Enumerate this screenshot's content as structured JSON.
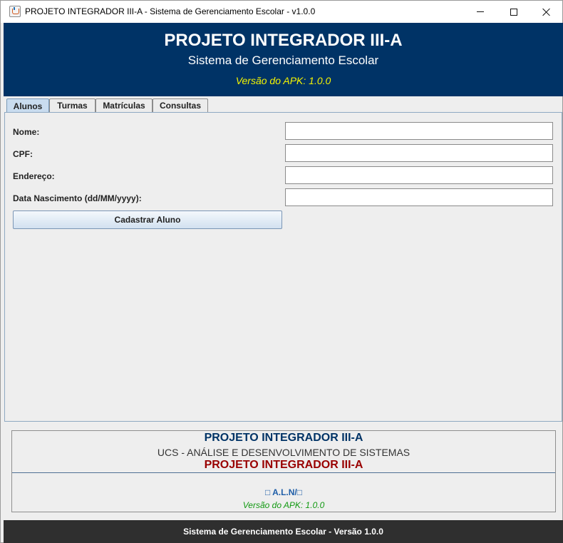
{
  "window": {
    "title": "PROJETO INTEGRADOR III-A - Sistema de Gerenciamento Escolar - v1.0.0",
    "icon": "java-cup-icon"
  },
  "header": {
    "title": "PROJETO INTEGRADOR III-A",
    "subtitle": "Sistema de Gerenciamento Escolar",
    "version": "Versão do APK: 1.0.0",
    "background_color": "#003366",
    "version_color": "#f5f500"
  },
  "tabs": [
    {
      "label": "Alunos",
      "selected": true
    },
    {
      "label": "Turmas",
      "selected": false
    },
    {
      "label": "Matrículas",
      "selected": false
    },
    {
      "label": "Consultas",
      "selected": false
    }
  ],
  "form": {
    "fields": [
      {
        "label": "Nome:",
        "value": ""
      },
      {
        "label": "CPF:",
        "value": ""
      },
      {
        "label": "Endereço:",
        "value": ""
      },
      {
        "label": "Data Nascimento (dd/MM/yyyy):",
        "value": ""
      }
    ],
    "submit_label": "Cadastrar Aluno"
  },
  "info": {
    "title": "PROJETO INTEGRADOR III-A",
    "org": "UCS - ANÁLISE E DESENVOLVIMENTO DE SISTEMAS",
    "project": "PROJETO INTEGRADOR III-A",
    "author": "□ A.L.N/□",
    "version": "Versão do APK: 1.0.0",
    "title_color": "#003366",
    "project_color": "#990000",
    "version_color": "#119911"
  },
  "status_bar": {
    "text": "Sistema de Gerenciamento Escolar - Versão 1.0.0",
    "background_color": "#2f2f2f"
  }
}
